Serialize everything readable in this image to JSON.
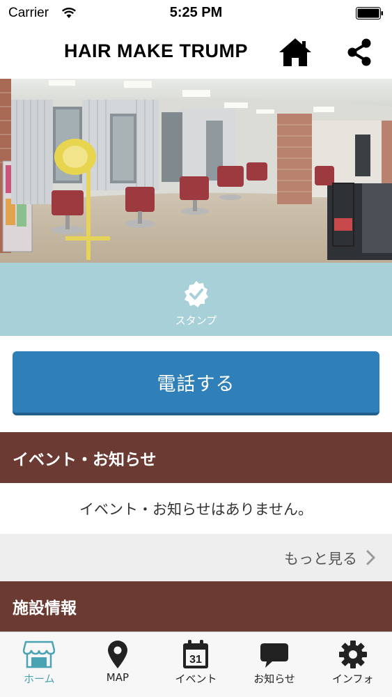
{
  "status_bar": {
    "carrier": "Carrier",
    "time": "5:25 PM",
    "wifi_icon": "wifi-icon",
    "battery_icon": "battery-icon"
  },
  "nav": {
    "title": "HAIR MAKE TRUMP",
    "home_icon": "home-icon",
    "share_icon": "share-icon"
  },
  "hero": {
    "image": "salon-interior-panorama"
  },
  "stamp": {
    "label": "スタンプ",
    "icon": "check-badge-icon",
    "background": "#a8d0d9"
  },
  "call": {
    "label": "電話する",
    "color": "#2f7fb8"
  },
  "events": {
    "header": "イベント・お知らせ",
    "empty_message": "イベント・お知らせはありません。",
    "more_label": "もっと見る",
    "header_color": "#6b3a32"
  },
  "facility": {
    "header": "施設情報"
  },
  "tab_bar": {
    "active_color": "#4aa3b2",
    "tabs": [
      {
        "label": "ホーム",
        "icon": "store-icon",
        "active": true
      },
      {
        "label": "MAP",
        "icon": "map-pin-icon",
        "active": false
      },
      {
        "label": "イベント",
        "icon": "calendar-icon",
        "active": false
      },
      {
        "label": "お知らせ",
        "icon": "chat-bubble-icon",
        "active": false
      },
      {
        "label": "インフォ",
        "icon": "gear-icon",
        "active": false
      }
    ],
    "calendar_day": "31"
  }
}
